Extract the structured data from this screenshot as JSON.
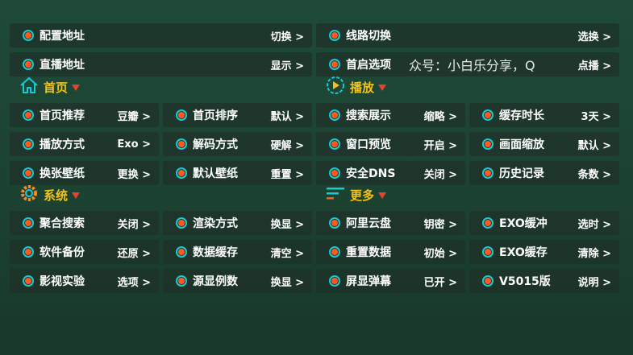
{
  "top": {
    "config_address": {
      "label": "配置地址",
      "value": "切换 >"
    },
    "line_switch": {
      "label": "线路切换",
      "value": "选换 >"
    },
    "live_address": {
      "label": "直播地址",
      "value": "显示 >"
    },
    "startup_option": {
      "label": "首启选项",
      "marquee": "众号：小白乐分享，Q",
      "value": "点播 >"
    }
  },
  "sections": {
    "home": {
      "title": "首页",
      "icon": "home-icon"
    },
    "play": {
      "title": "播放",
      "icon": "play-circle-icon"
    },
    "system": {
      "title": "系统",
      "icon": "gear-icon"
    },
    "more": {
      "title": "更多",
      "icon": "menu-lines-icon"
    }
  },
  "grid1": [
    [
      {
        "label": "首页推荐",
        "value": "豆瓣 >"
      },
      {
        "label": "首页排序",
        "value": "默认 >"
      },
      {
        "label": "搜索展示",
        "value": "缩略 >"
      },
      {
        "label": "缓存时长",
        "value": "3天 >"
      }
    ],
    [
      {
        "label": "播放方式",
        "value": "Exo >"
      },
      {
        "label": "解码方式",
        "value": "硬解 >"
      },
      {
        "label": "窗口预览",
        "value": "开启 >"
      },
      {
        "label": "画面缩放",
        "value": "默认 >"
      }
    ],
    [
      {
        "label": "换张壁纸",
        "value": "更换 >"
      },
      {
        "label": "默认壁纸",
        "value": "重置 >"
      },
      {
        "label": "安全DNS",
        "value": "关闭 >"
      },
      {
        "label": "历史记录",
        "value": "条数 >"
      }
    ]
  ],
  "grid2": [
    [
      {
        "label": "聚合搜索",
        "value": "关闭 >"
      },
      {
        "label": "渲染方式",
        "value": "换显 >"
      },
      {
        "label": "阿里云盘",
        "value": "钥密 >"
      },
      {
        "label": "EXO缓冲",
        "value": "选时 >"
      }
    ],
    [
      {
        "label": "软件备份",
        "value": "还原 >"
      },
      {
        "label": "数据缓存",
        "value": "清空 >"
      },
      {
        "label": "重置数据",
        "value": "初始 >"
      },
      {
        "label": "EXO缓存",
        "value": "清除 >"
      }
    ],
    [
      {
        "label": "影视实验",
        "value": "选项 >"
      },
      {
        "label": "源显例数",
        "value": "换显 >"
      },
      {
        "label": "屏显弹幕",
        "value": "已开 >"
      },
      {
        "label": "V5015版",
        "value": "说明 >"
      }
    ]
  ],
  "colors": {
    "accent_yellow": "#f1c21b",
    "dot_ring": "#18c9d6",
    "dot_fill": "#ff5a1f",
    "arrow_red": "#e8412f"
  }
}
